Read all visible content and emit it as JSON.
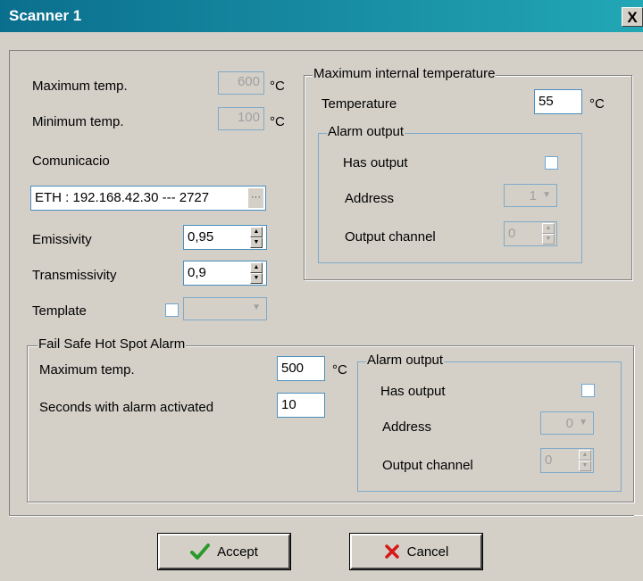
{
  "window": {
    "title": "Scanner 1",
    "close_glyph": "X"
  },
  "left": {
    "max_temp_label": "Maximum temp.",
    "max_temp_value": "600",
    "max_temp_unit": "°C",
    "min_temp_label": "Minimum temp.",
    "min_temp_value": "100",
    "min_temp_unit": "°C",
    "comm_label": "Comunicacio",
    "comm_value": "ETH : 192.168.42.30 --- 2727",
    "comm_browse": "···",
    "emissivity_label": "Emissivity",
    "emissivity_value": "0,95",
    "transmissivity_label": "Transmissivity",
    "transmissivity_value": "0,9",
    "template_label": "Template"
  },
  "internal": {
    "legend": "Maximum internal temperature",
    "temperature_label": "Temperature",
    "temperature_value": "55",
    "temperature_unit": "°C",
    "alarm": {
      "legend": "Alarm output",
      "has_output_label": "Has output",
      "address_label": "Address",
      "address_value": "1",
      "channel_label": "Output channel",
      "channel_value": "0"
    }
  },
  "failsafe": {
    "legend": "Fail Safe Hot Spot Alarm",
    "max_temp_label": "Maximum temp.",
    "max_temp_value": "500",
    "max_temp_unit": "°C",
    "seconds_label": "Seconds with alarm activated",
    "seconds_value": "10",
    "alarm": {
      "legend": "Alarm output",
      "has_output_label": "Has output",
      "address_label": "Address",
      "address_value": "0",
      "channel_label": "Output channel",
      "channel_value": "0"
    }
  },
  "buttons": {
    "accept": "Accept",
    "cancel": "Cancel"
  },
  "colors": {
    "titlebar": "#0a6f8e",
    "accept_check": "#2a9a2a",
    "cancel_x": "#d81818"
  }
}
